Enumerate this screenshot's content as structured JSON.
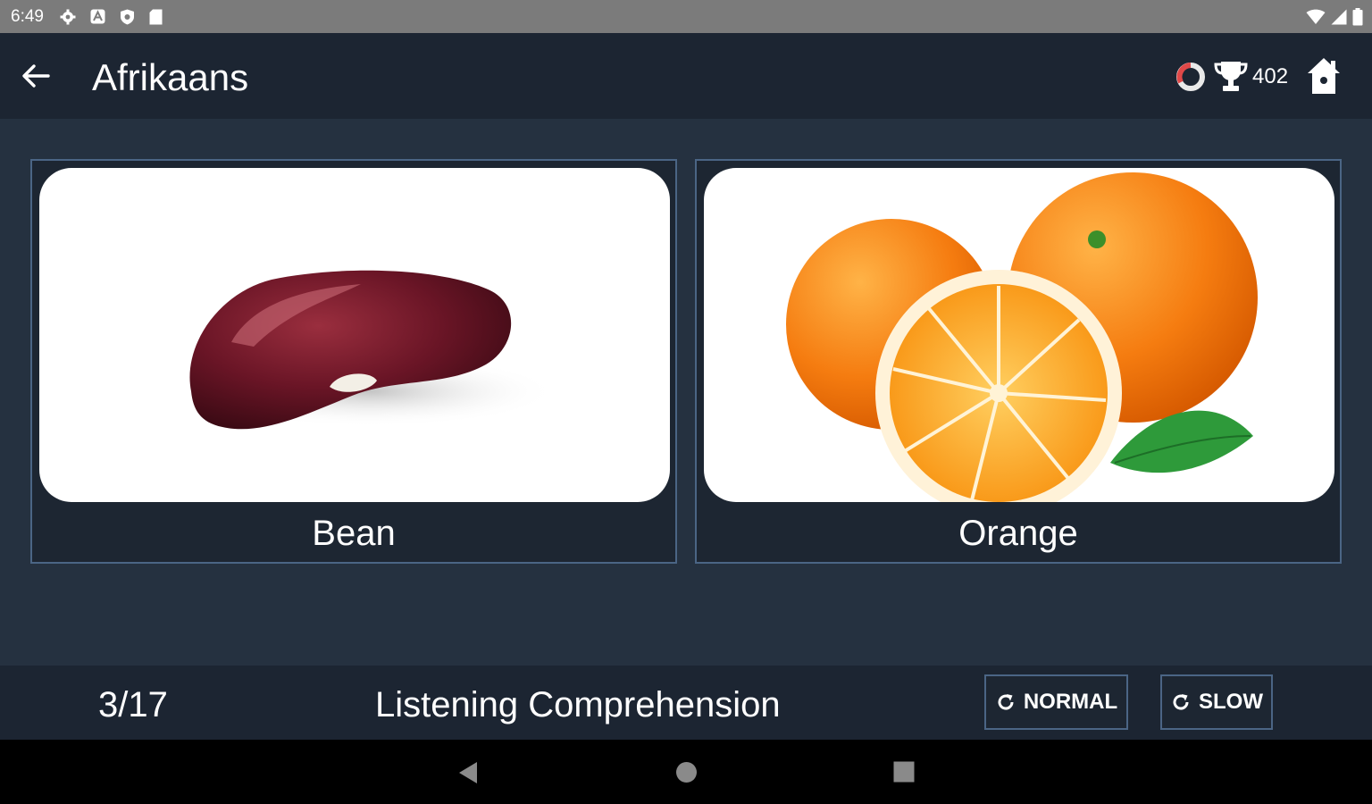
{
  "status_bar": {
    "time": "6:49",
    "icons": [
      "gear-icon",
      "app-a-icon",
      "shield-icon",
      "sd-card-icon",
      "wifi-icon",
      "cellular-icon",
      "battery-icon"
    ]
  },
  "app_bar": {
    "title": "Afrikaans",
    "score": "402",
    "icons": [
      "back-arrow-icon",
      "ring-icon",
      "trophy-icon",
      "home-icon"
    ]
  },
  "choices": [
    {
      "label": "Bean",
      "image": "kidney-bean"
    },
    {
      "label": "Orange",
      "image": "oranges"
    }
  ],
  "footer": {
    "progress": "3/17",
    "mode": "Listening Comprehension",
    "normal_label": "NORMAL",
    "slow_label": "SLOW"
  },
  "colors": {
    "background": "#253140",
    "bar": "#1c2532",
    "border": "#4b6585"
  }
}
